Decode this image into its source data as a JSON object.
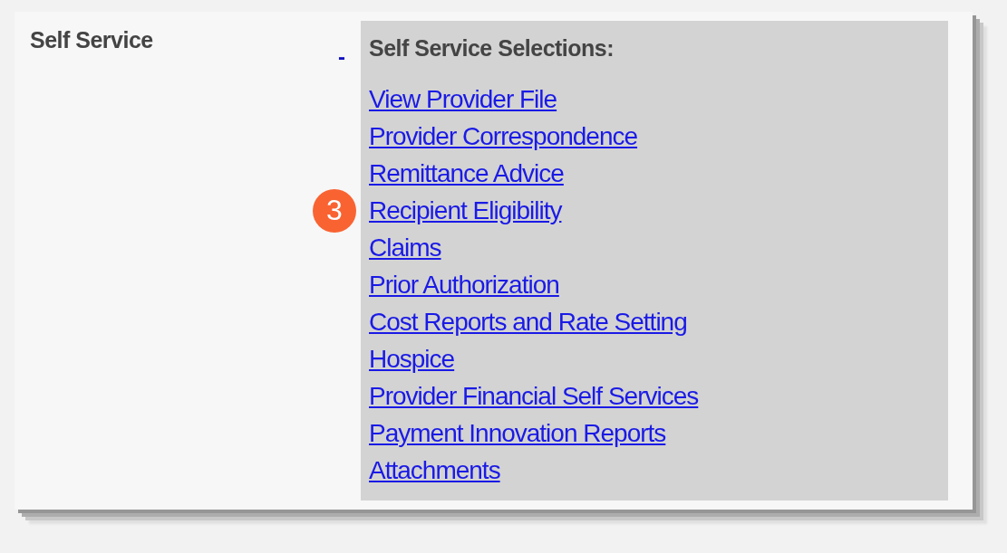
{
  "section": {
    "label": "Self Service",
    "collapse_toggle": "-"
  },
  "panel": {
    "title": "Self Service Selections:",
    "links": [
      {
        "label": "View Provider File"
      },
      {
        "label": "Provider Correspondence"
      },
      {
        "label": "Remittance Advice"
      },
      {
        "label": "Recipient Eligibility",
        "callout": "3"
      },
      {
        "label": "Claims"
      },
      {
        "label": "Prior Authorization"
      },
      {
        "label": "Cost Reports and Rate Setting"
      },
      {
        "label": "Hospice"
      },
      {
        "label": "Provider Financial Self Services"
      },
      {
        "label": "Payment Innovation Reports"
      },
      {
        "label": "Attachments"
      }
    ]
  }
}
